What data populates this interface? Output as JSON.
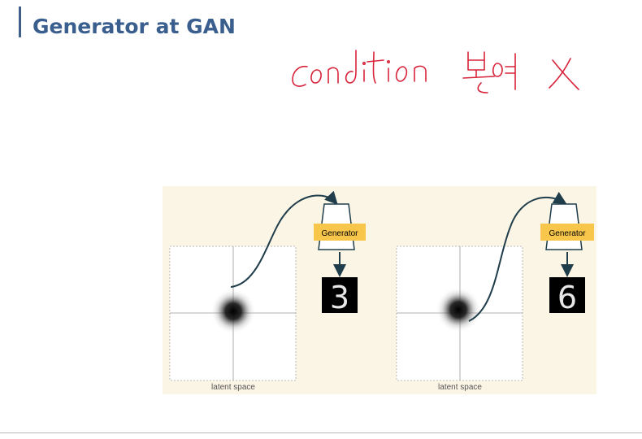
{
  "slide": {
    "title": "Generator at GAN",
    "handwritten_note": "condition 부여 X"
  },
  "figure": {
    "panels": [
      {
        "generator_label": "Generator",
        "output_digit": "3",
        "axis_label": "latent space"
      },
      {
        "generator_label": "Generator",
        "output_digit": "6",
        "axis_label": "latent space"
      }
    ]
  },
  "colors": {
    "title": "#3a5f8e",
    "accent_bar": "#3d5f8a",
    "handwriting": "#d8243a",
    "figure_bg": "#fbf5e6",
    "generator_label_bg": "#f7c64a",
    "arrow": "#1f3d4a"
  }
}
